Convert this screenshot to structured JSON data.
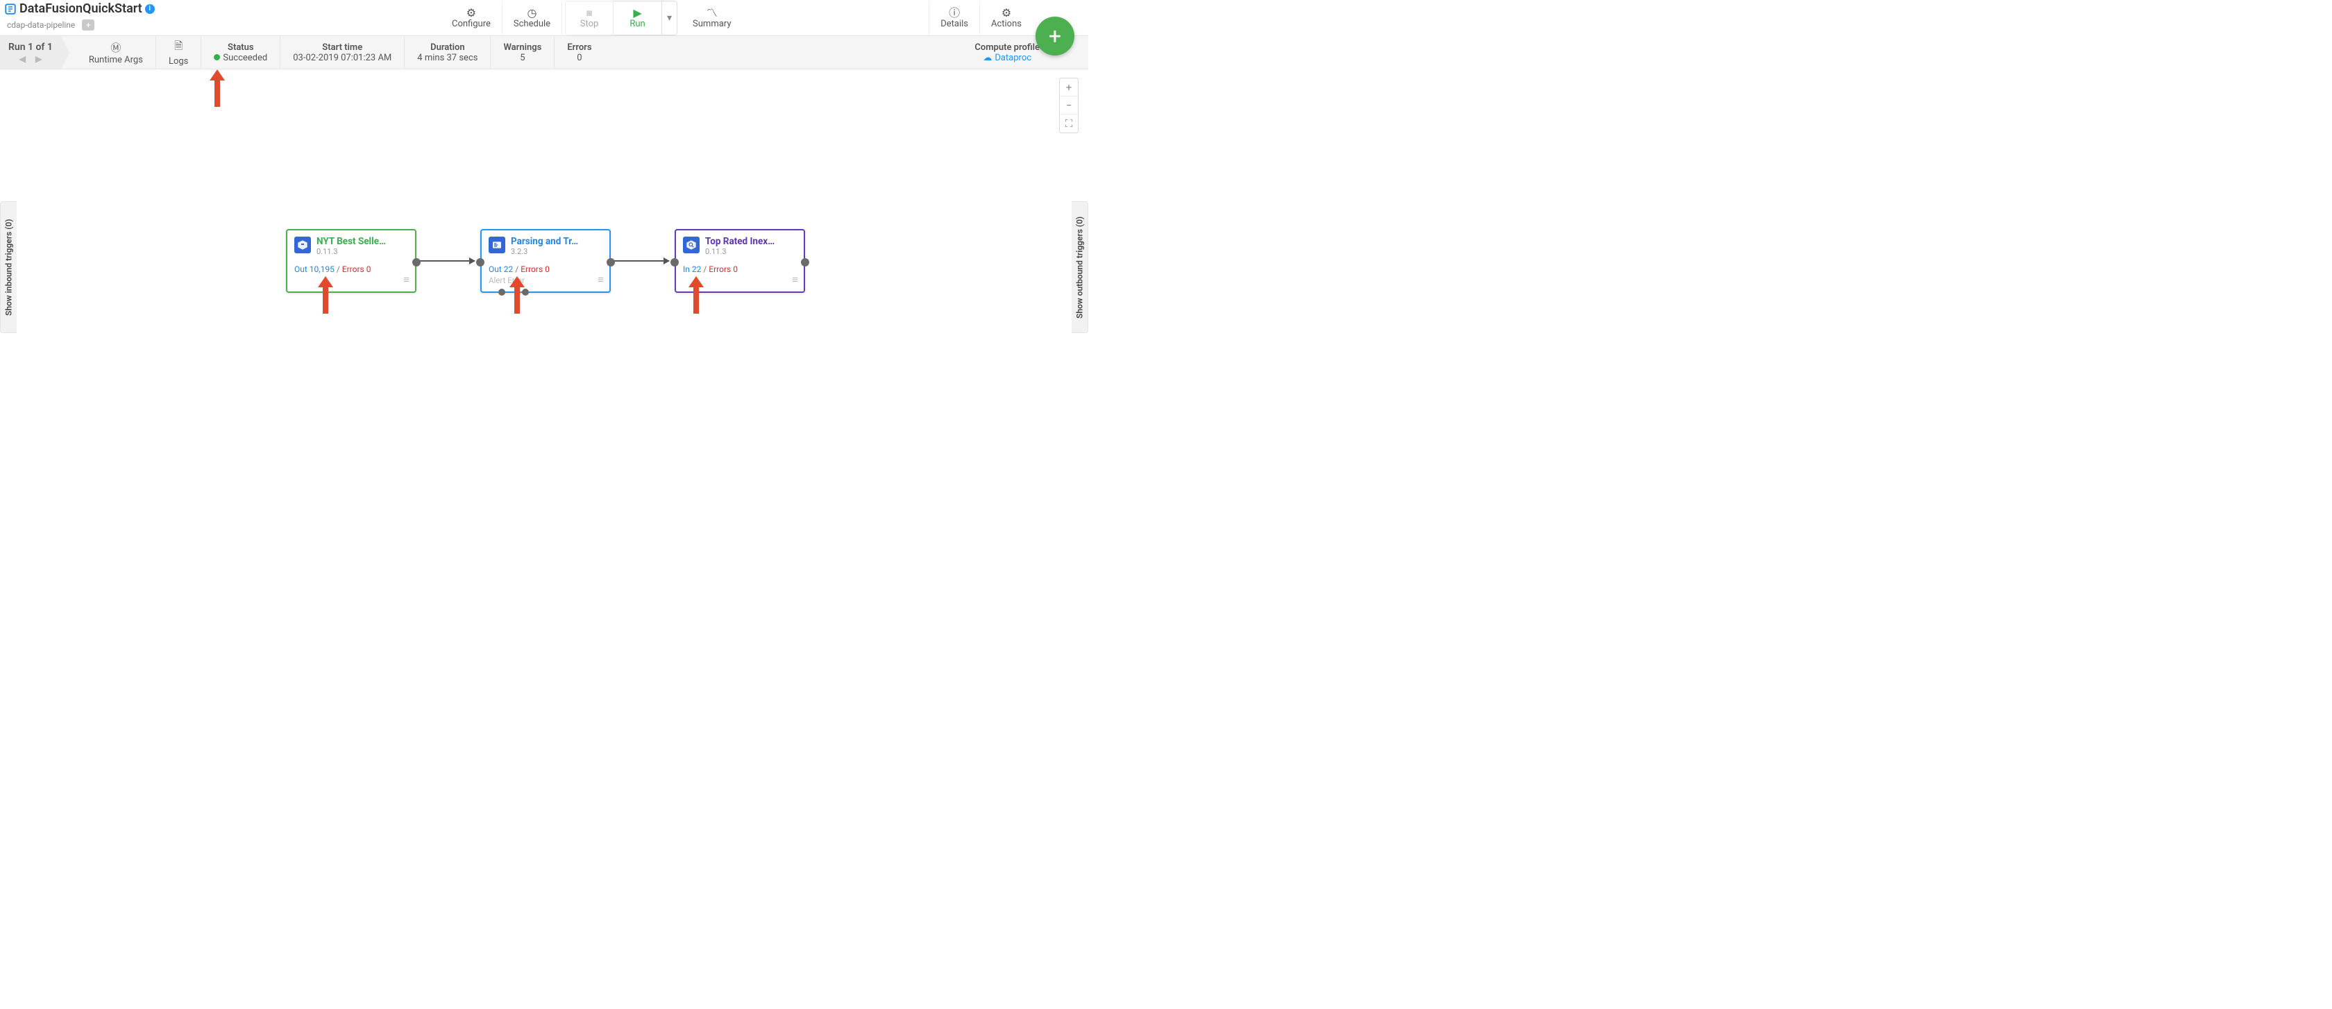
{
  "title": "DataFusionQuickStart",
  "breadcrumb": "cdap-data-pipeline",
  "toolbar": {
    "configure": "Configure",
    "schedule": "Schedule",
    "stop": "Stop",
    "run": "Run",
    "summary": "Summary",
    "details": "Details",
    "actions": "Actions"
  },
  "run": {
    "label": "Run 1 of 1",
    "runtime_args": "Runtime Args",
    "logs": "Logs",
    "status_label": "Status",
    "status_value": "Succeeded",
    "start_label": "Start time",
    "start_value": "03-02-2019 07:01:23 AM",
    "duration_label": "Duration",
    "duration_value": "4 mins 37 secs",
    "warnings_label": "Warnings",
    "warnings_value": "5",
    "errors_label": "Errors",
    "errors_value": "0",
    "profile_label": "Compute profile",
    "profile_value": "Dataproc"
  },
  "rails": {
    "inbound": "Show inbound triggers (0)",
    "outbound": "Show outbound triggers (0)"
  },
  "nodes": [
    {
      "title": "NYT Best Selle…",
      "version": "0.11.3",
      "stat_prefix": "Out",
      "stat_count": "10,195",
      "stat_err_label": "Errors",
      "stat_err": "0",
      "extra": ""
    },
    {
      "title": "Parsing and Tr…",
      "version": "3.2.3",
      "stat_prefix": "Out",
      "stat_count": "22",
      "stat_err_label": "Errors",
      "stat_err": "0",
      "extra": "Alert   Error"
    },
    {
      "title": "Top Rated Inex…",
      "version": "0.11.3",
      "stat_prefix": "In",
      "stat_count": "22",
      "stat_err_label": "Errors",
      "stat_err": "0",
      "extra": ""
    }
  ]
}
